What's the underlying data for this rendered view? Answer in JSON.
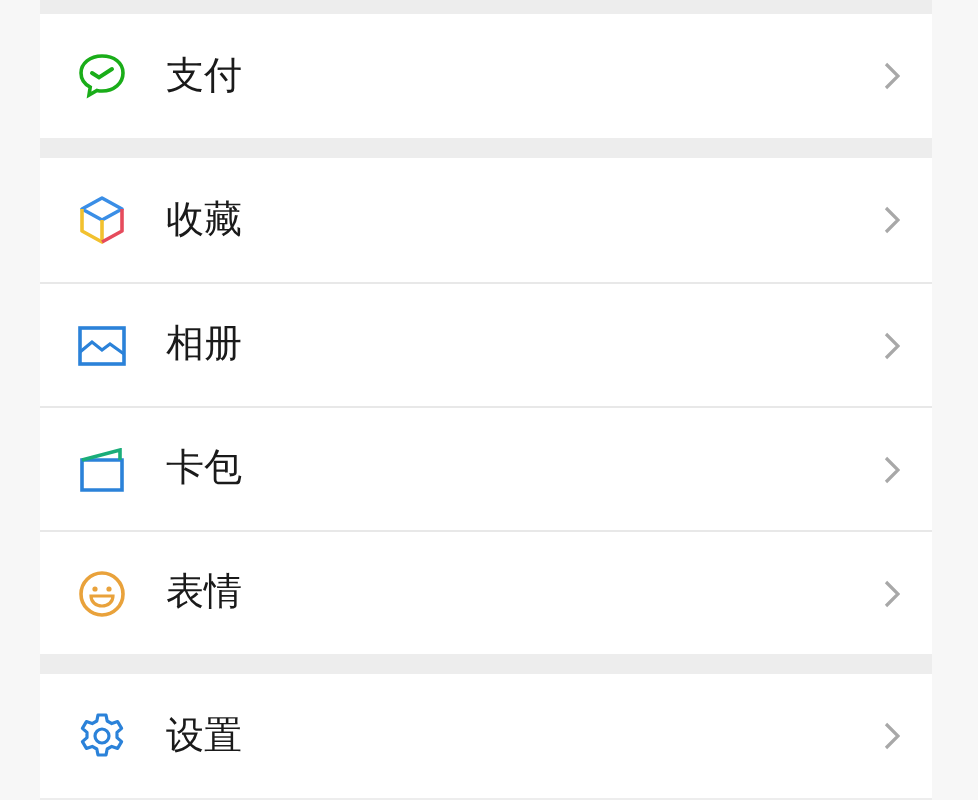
{
  "groups": [
    {
      "items": [
        {
          "label": "支付",
          "kind": "pay"
        }
      ]
    },
    {
      "items": [
        {
          "label": "收藏",
          "kind": "favorites"
        },
        {
          "label": "相册",
          "kind": "album"
        },
        {
          "label": "卡包",
          "kind": "cards"
        },
        {
          "label": "表情",
          "kind": "stickers"
        }
      ]
    },
    {
      "items": [
        {
          "label": "设置",
          "kind": "settings"
        }
      ]
    }
  ]
}
